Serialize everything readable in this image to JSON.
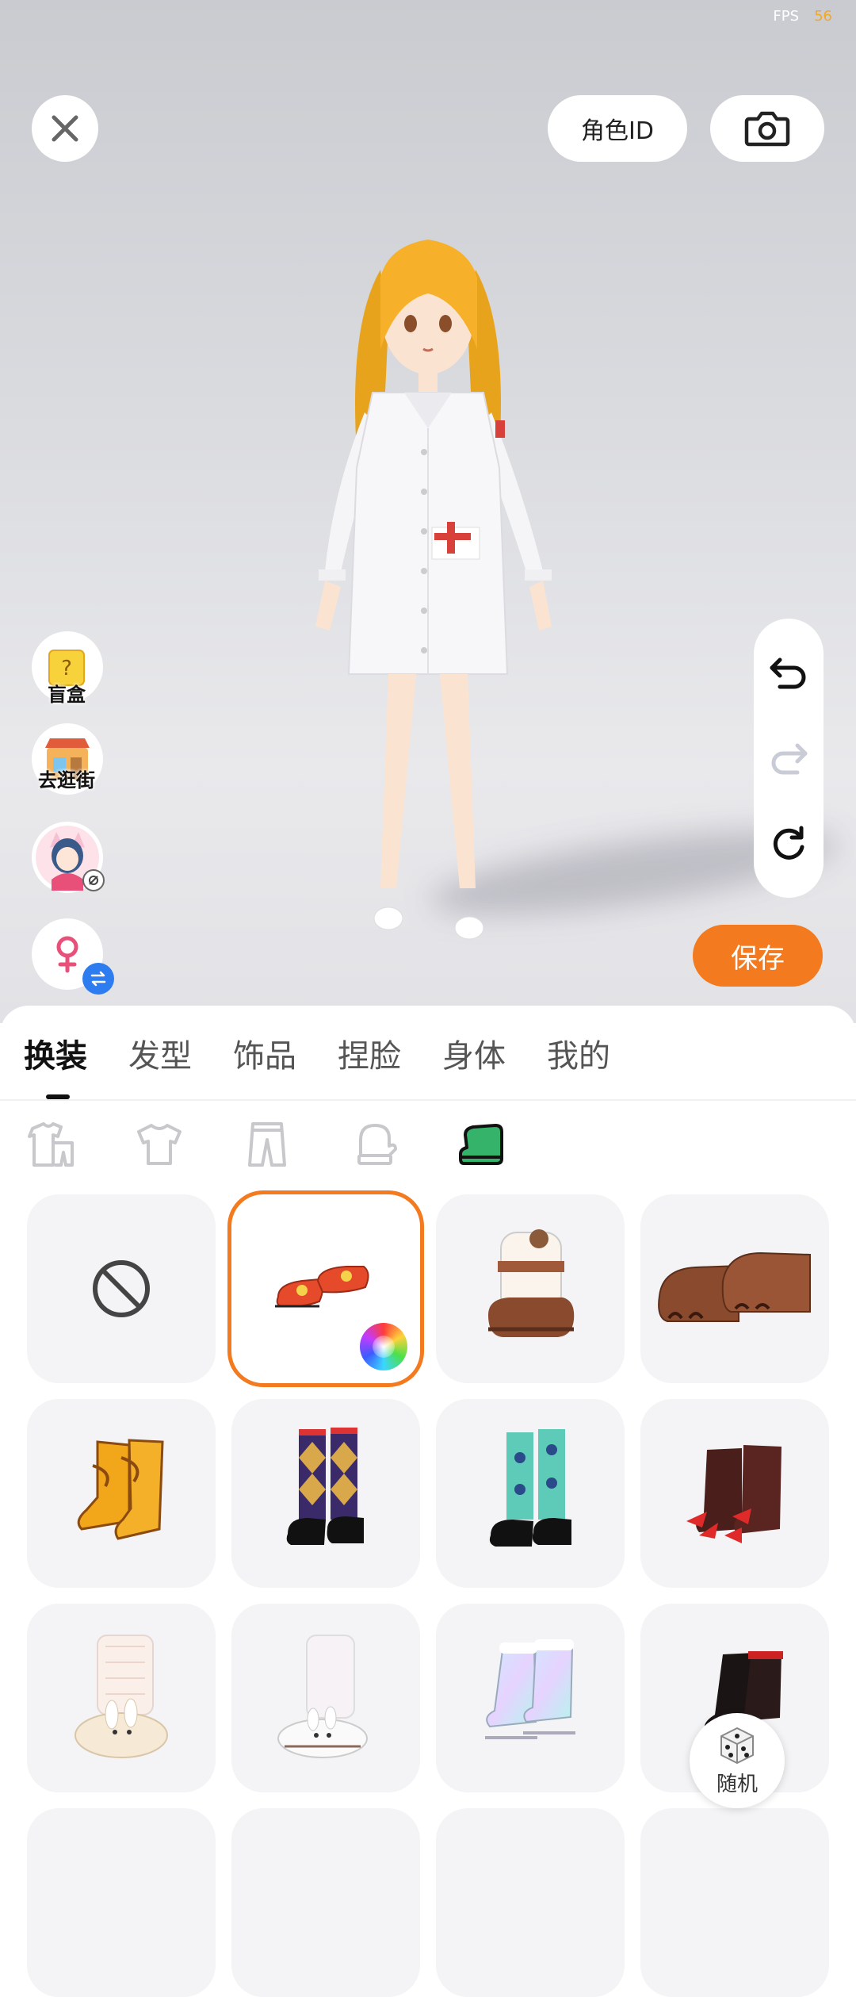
{
  "status": {
    "fps_label": "FPS",
    "fps_value": "56"
  },
  "header": {
    "role_id_label": "角色ID"
  },
  "left_tools": {
    "blind_box_label": "盲盒",
    "shopping_label": "去逛街"
  },
  "save_label": "保存",
  "tabs": [
    {
      "label": "换装",
      "active": true
    },
    {
      "label": "发型"
    },
    {
      "label": "饰品"
    },
    {
      "label": "捏脸"
    },
    {
      "label": "身体"
    },
    {
      "label": "我的"
    }
  ],
  "categories": [
    "set-icon",
    "top-icon",
    "pants-icon",
    "gloves-icon",
    "shoes-icon"
  ],
  "selected_category": "shoes-icon",
  "items": [
    {
      "name": "none",
      "selected": false
    },
    {
      "name": "red-slippers",
      "selected": true,
      "color_picker": true
    },
    {
      "name": "bear-boots"
    },
    {
      "name": "paw-feet"
    },
    {
      "name": "yellow-claw-boots"
    },
    {
      "name": "argyle-socks-shoes"
    },
    {
      "name": "teal-socks-shoes"
    },
    {
      "name": "dark-claw-feet"
    },
    {
      "name": "bunny-slippers-cream"
    },
    {
      "name": "bunny-slippers-white"
    },
    {
      "name": "holo-boots"
    },
    {
      "name": "black-red-boots"
    }
  ],
  "random_label": "随机",
  "colors": {
    "accent": "#f47a1f",
    "shoes_tab": "#36b36a"
  }
}
